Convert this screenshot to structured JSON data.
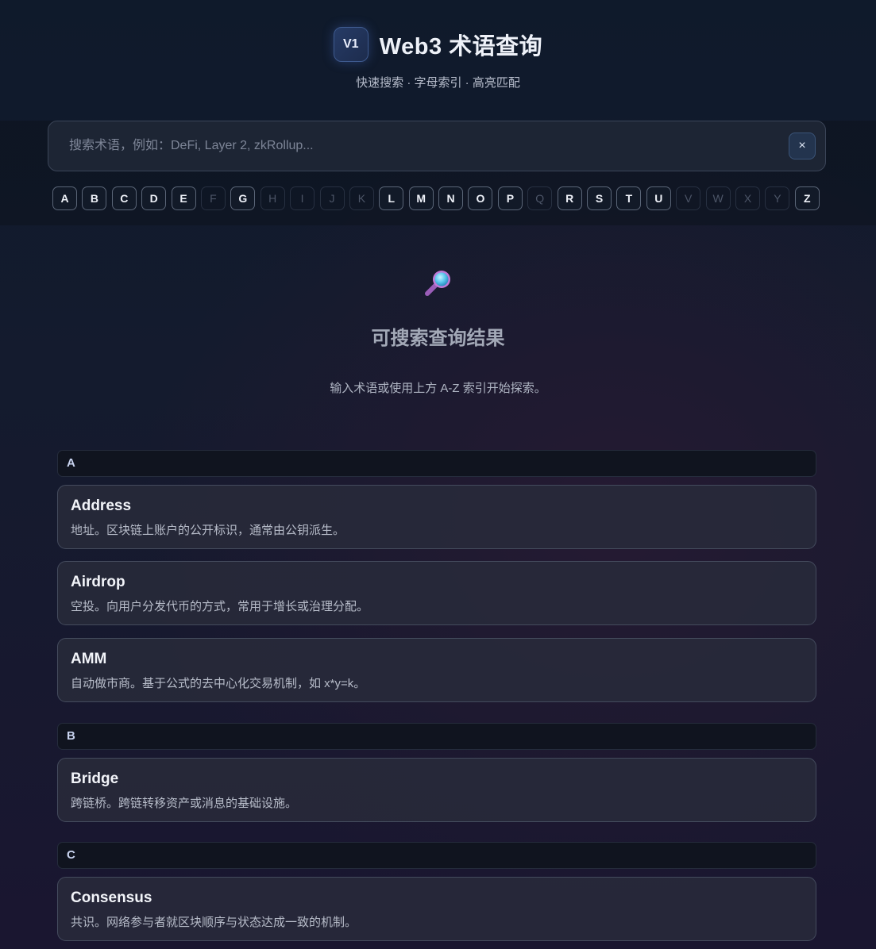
{
  "header": {
    "logo_text": "V1",
    "title": "Web3 术语查询",
    "subtitle": "快速搜索 · 字母索引 · 高亮匹配"
  },
  "search": {
    "placeholder": "搜索术语，例如：DeFi, Layer 2, zkRollup...",
    "value": "",
    "clear_label": "×"
  },
  "az_index": [
    {
      "letter": "A",
      "enabled": true
    },
    {
      "letter": "B",
      "enabled": true
    },
    {
      "letter": "C",
      "enabled": true
    },
    {
      "letter": "D",
      "enabled": true
    },
    {
      "letter": "E",
      "enabled": true
    },
    {
      "letter": "F",
      "enabled": false
    },
    {
      "letter": "G",
      "enabled": true
    },
    {
      "letter": "H",
      "enabled": false
    },
    {
      "letter": "I",
      "enabled": false
    },
    {
      "letter": "J",
      "enabled": false
    },
    {
      "letter": "K",
      "enabled": false
    },
    {
      "letter": "L",
      "enabled": true
    },
    {
      "letter": "M",
      "enabled": true
    },
    {
      "letter": "N",
      "enabled": true
    },
    {
      "letter": "O",
      "enabled": true
    },
    {
      "letter": "P",
      "enabled": true
    },
    {
      "letter": "Q",
      "enabled": false
    },
    {
      "letter": "R",
      "enabled": true
    },
    {
      "letter": "S",
      "enabled": true
    },
    {
      "letter": "T",
      "enabled": true
    },
    {
      "letter": "U",
      "enabled": true
    },
    {
      "letter": "V",
      "enabled": false
    },
    {
      "letter": "W",
      "enabled": false
    },
    {
      "letter": "X",
      "enabled": false
    },
    {
      "letter": "Y",
      "enabled": false
    },
    {
      "letter": "Z",
      "enabled": true
    }
  ],
  "empty_state": {
    "icon": "magnifier-icon",
    "title": "可搜索查询结果",
    "description": "输入术语或使用上方 A-Z 索引开始探索。"
  },
  "sections": [
    {
      "letter": "A",
      "terms": [
        {
          "term": "Address",
          "definition": "地址。区块链上账户的公开标识，通常由公钥派生。"
        },
        {
          "term": "Airdrop",
          "definition": "空投。向用户分发代币的方式，常用于增长或治理分配。"
        },
        {
          "term": "AMM",
          "definition": "自动做市商。基于公式的去中心化交易机制，如 x*y=k。"
        }
      ]
    },
    {
      "letter": "B",
      "terms": [
        {
          "term": "Bridge",
          "definition": "跨链桥。跨链转移资产或消息的基础设施。"
        }
      ]
    },
    {
      "letter": "C",
      "terms": [
        {
          "term": "Consensus",
          "definition": "共识。网络参与者就区块顺序与状态达成一致的机制。"
        }
      ]
    }
  ],
  "colors": {
    "accent": "#3e5a8e",
    "background": "#141b2e",
    "card": "#28293a"
  }
}
